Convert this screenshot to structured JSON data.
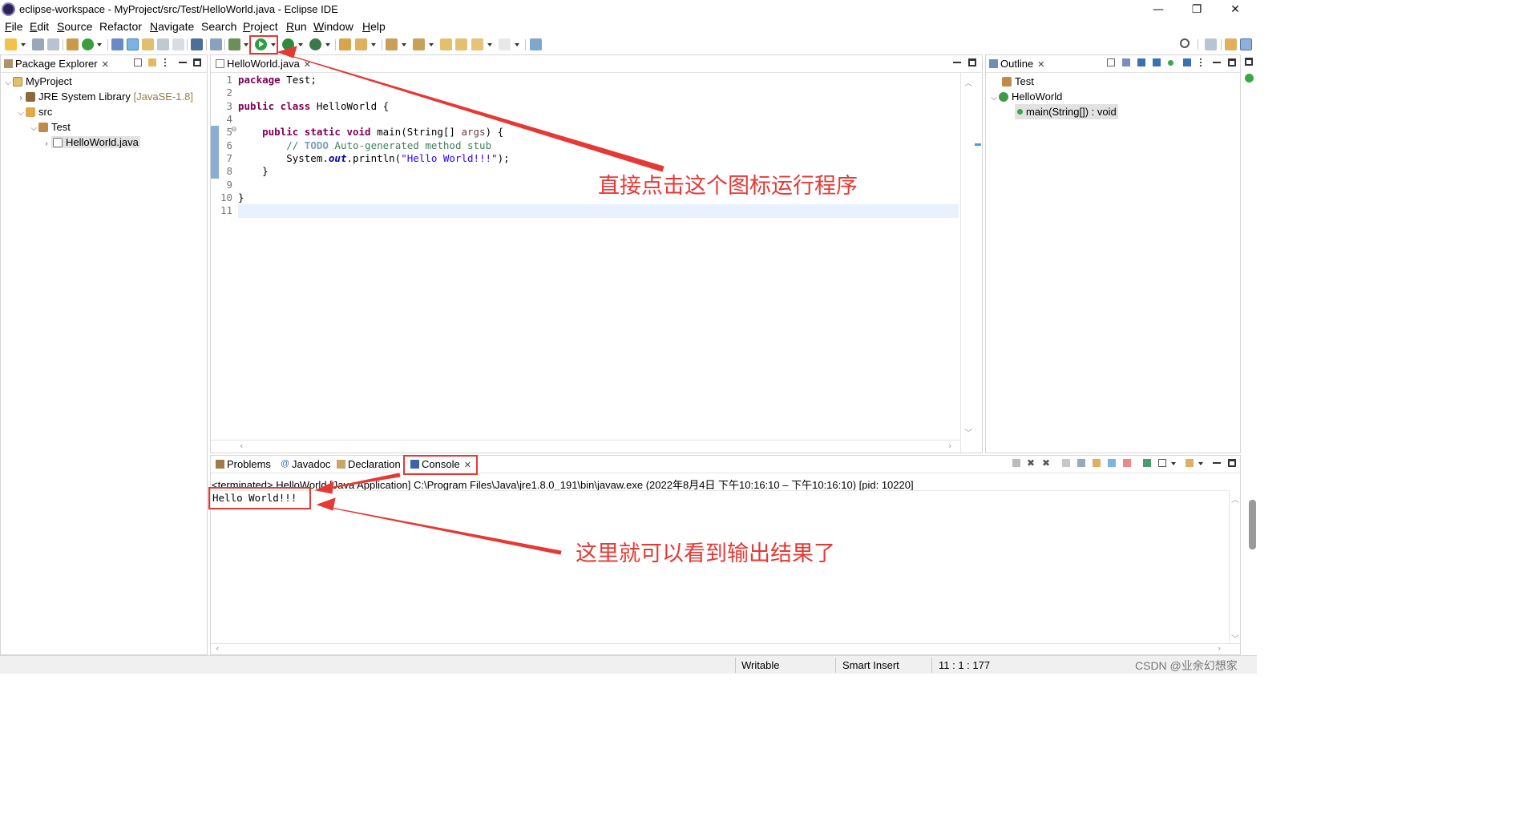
{
  "window": {
    "title": "eclipse-workspace - MyProject/src/Test/HelloWorld.java - Eclipse IDE",
    "minimize": "—",
    "restore": "❐",
    "close": "✕"
  },
  "menu": [
    {
      "underline": "F",
      "rest": "ile"
    },
    {
      "underline": "E",
      "rest": "dit"
    },
    {
      "underline": "S",
      "rest": "ource"
    },
    {
      "underline": "",
      "rest": "Refactor"
    },
    {
      "underline": "N",
      "rest": "avigate"
    },
    {
      "underline": "",
      "rest": "Search"
    },
    {
      "underline": "P",
      "rest": "roject"
    },
    {
      "underline": "R",
      "rest": "un"
    },
    {
      "underline": "W",
      "rest": "indow"
    },
    {
      "underline": "H",
      "rest": "elp"
    }
  ],
  "package_explorer": {
    "tab": "Package Explorer",
    "tree": [
      {
        "label": "MyProject",
        "extra": ""
      },
      {
        "label": "JRE System Library",
        "extra": "[JavaSE-1.8]"
      },
      {
        "label": "src",
        "extra": ""
      },
      {
        "label": "Test",
        "extra": ""
      },
      {
        "label": "HelloWorld.java",
        "extra": ""
      }
    ]
  },
  "editor": {
    "tab": "HelloWorld.java",
    "line_numbers": [
      "1",
      "2",
      "3",
      "4",
      "5",
      "6",
      "7",
      "8",
      "9",
      "10",
      "11"
    ],
    "fold_marker": "⊖",
    "code": {
      "l1_kw": "package",
      "l1_rest": " Test;",
      "l3_kw": "public class",
      "l3_rest": " HelloWorld {",
      "l5_indent": "    ",
      "l5_kw": "public static void",
      "l5_a": " main(String[] ",
      "l5_args": "args",
      "l5_b": ") {",
      "l6_indent": "        ",
      "l6_comment": "// ",
      "l6_todo": "TODO",
      "l6_comment2": " Auto-generated method stub",
      "l7_a": "        System.",
      "l7_field": "out",
      "l7_b": ".println(",
      "l7_str": "\"Hello World!!!\"",
      "l7_c": ");",
      "l8": "    }",
      "l10": "}"
    }
  },
  "outline": {
    "tab": "Outline",
    "tree": [
      {
        "label": "Test"
      },
      {
        "label": "HelloWorld"
      },
      {
        "label": "main(String[]) : void"
      }
    ]
  },
  "console": {
    "tabs": [
      "Problems",
      "Javadoc",
      "Declaration",
      "Console"
    ],
    "header": "<terminated> HelloWorld [Java Application] C:\\Program Files\\Java\\jre1.8.0_191\\bin\\javaw.exe  (2022年8月4日 下午10:16:10 – 下午10:16:10) [pid: 10220]",
    "output": "Hello World!!!"
  },
  "annotations": {
    "run_hint": "直接点击这个图标运行程序",
    "output_hint": "这里就可以看到输出结果了",
    "color": "#e53935"
  },
  "status": {
    "writable": "Writable",
    "insert_mode": "Smart Insert",
    "position": "11 : 1 : 177",
    "watermark": "CSDN @业余幻想家"
  }
}
